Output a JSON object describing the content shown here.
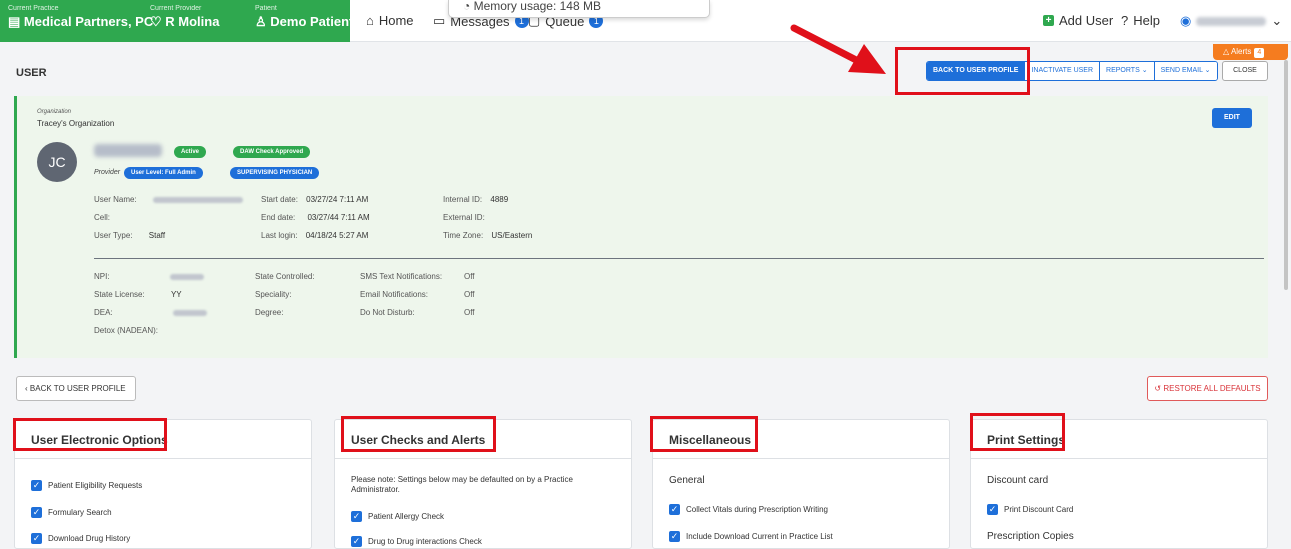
{
  "topbar": {
    "practice_label": "Current Practice",
    "practice_value": "Medical Partners, PC",
    "provider_label": "Current Provider",
    "provider_value": "R Molina",
    "patient_label": "Patient",
    "patient_value": "Demo Patient",
    "nav": [
      {
        "label": "Home",
        "icon": "home-icon"
      },
      {
        "label": "Messages",
        "icon": "chat-icon",
        "badge": "1"
      },
      {
        "label": "Queue",
        "icon": "calendar-icon",
        "badge": "1"
      }
    ],
    "memory_tooltip": "Memory usage: 148 MB",
    "add_user": "Add User",
    "help": "Help",
    "alerts_label": "Alerts",
    "alerts_count": "4"
  },
  "page": {
    "title": "USER",
    "actions": [
      "BACK TO USER PROFILE",
      "INACTIVATE USER",
      "REPORTS",
      "SEND EMAIL"
    ],
    "close": "CLOSE"
  },
  "profile": {
    "org_label": "Organization",
    "org_value": "Tracey's Organization",
    "edit": "EDIT",
    "initials": "JC",
    "badges": [
      "Active",
      "DAW Check Approved"
    ],
    "role_label": "Provider",
    "role_badges": [
      "User Level: Full Admin",
      "SUPERVISING PHYSICIAN"
    ],
    "rows1": [
      {
        "label": "User Name:",
        "value": ""
      },
      {
        "label": "Cell:",
        "value": ""
      },
      {
        "label": "User Type:",
        "value": "Staff"
      }
    ],
    "rows2": [
      {
        "label": "Start date:",
        "value": "03/27/24 7:11 AM"
      },
      {
        "label": "End date:",
        "value": "03/27/44 7:11 AM"
      },
      {
        "label": "Last login:",
        "value": "04/18/24 5:27 AM"
      }
    ],
    "rows3": [
      {
        "label": "Internal ID:",
        "value": "4889"
      },
      {
        "label": "External ID:",
        "value": ""
      },
      {
        "label": "Time Zone:",
        "value": "US/Eastern"
      }
    ],
    "rows4": [
      {
        "label": "NPI:",
        "value": ""
      },
      {
        "label": "State License:",
        "value": "YY"
      },
      {
        "label": "DEA:",
        "value": ""
      },
      {
        "label": "Detox (NADEAN):",
        "value": ""
      }
    ],
    "rows5": [
      {
        "label": "State Controlled:",
        "value": ""
      },
      {
        "label": "Speciality:",
        "value": ""
      },
      {
        "label": "Degree:",
        "value": ""
      }
    ],
    "rows6": [
      {
        "label": "SMS Text Notifications:",
        "value": "Off"
      },
      {
        "label": "Email Notifications:",
        "value": "Off"
      },
      {
        "label": "Do Not Disturb:",
        "value": "Off"
      }
    ]
  },
  "controls": {
    "back": "BACK TO USER PROFILE",
    "restore": "RESTORE ALL DEFAULTS"
  },
  "panels": {
    "electronic": {
      "title": "User Electronic Options",
      "items": [
        "Patient Eligibility Requests",
        "Formulary Search",
        "Download Drug History"
      ]
    },
    "checks": {
      "title": "User Checks and Alerts",
      "note": "Please note: Settings below may be defaulted on by a Practice Administrator.",
      "items": [
        "Patient Allergy Check",
        "Drug to Drug interactions Check"
      ]
    },
    "misc": {
      "title": "Miscellaneous",
      "section": "General",
      "items": [
        "Collect Vitals during Prescription Writing",
        "Include Download Current in Practice List"
      ]
    },
    "print": {
      "title": "Print Settings",
      "section": "Discount card",
      "items": [
        "Print Discount Card"
      ],
      "section2": "Prescription Copies"
    }
  },
  "colors": {
    "brand_green": "#2fa84f",
    "primary_blue": "#1e6fd9",
    "alert_orange": "#f57c1f",
    "highlight_red": "#e0101a"
  }
}
